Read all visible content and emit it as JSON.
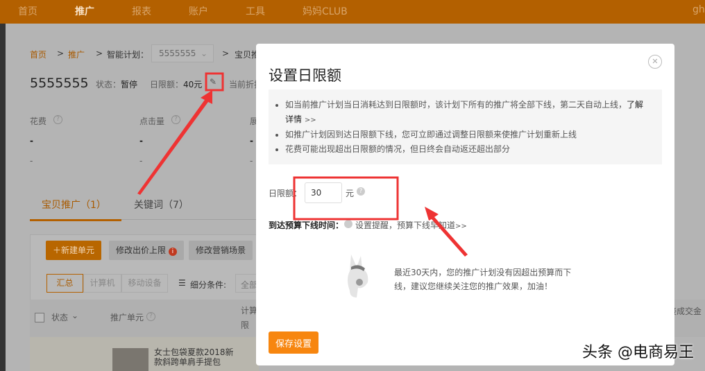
{
  "nav": {
    "items": [
      "首页",
      "推广",
      "报表",
      "账户",
      "工具",
      "妈妈CLUB"
    ],
    "active": 1,
    "user": "ghb"
  },
  "breadcrumb": {
    "home": "首页",
    "promo": "推广",
    "plan_label": "智能计划：",
    "plan_value": "5555555",
    "current": "宝贝推"
  },
  "plan": {
    "name": "5555555",
    "status_label": "状态：",
    "status": "暂停",
    "limit_label": "日限额：",
    "limit": "40元",
    "discount": "当前折扣"
  },
  "metrics": [
    {
      "label": "花费",
      "value": "-",
      "sub": "-"
    },
    {
      "label": "点击量",
      "value": "-",
      "sub": "-"
    },
    {
      "label": "展",
      "value": "-",
      "sub": "-"
    }
  ],
  "tabs": [
    {
      "label": "宝贝推广（1）"
    },
    {
      "label": "关键词（7）"
    }
  ],
  "toolbar": {
    "new_unit": "新建单元",
    "edit_bid": "修改出价上限",
    "edit_scene": "修改营销场景"
  },
  "device_tabs": [
    "汇总",
    "计算机",
    "移动设备"
  ],
  "filter": {
    "label": "细分条件:",
    "value": "全部"
  },
  "table": {
    "headers": [
      "状态",
      "推广单元",
      "计算机",
      "限",
      "接成交金"
    ],
    "row": {
      "title": "女士包袋夏款2018新款斜跨单肩手提包"
    }
  },
  "modal": {
    "title": "设置日限额",
    "tips": [
      "如当前推广计划当日消耗达到日限额时，该计划下所有的推广将全部下线，第二天自动上线，",
      "如推广计划因到达日限额下线，您可立即通过调整日限额来使推广计划重新上线",
      "花费可能出现超出日限额的情况，但日终会自动返还超出部分"
    ],
    "learn_more": "了解详情",
    "more": ">>",
    "limit_label": "日限额：",
    "limit_value": "30",
    "unit": "元",
    "offline_label": "到达预算下线时间：",
    "offline_text": "设置提醒，预算下线早知道",
    "message": "最近30天内，您的推广计划没有因超出预算而下线，建议您继续关注您的推广效果，加油！",
    "save": "保存设置"
  },
  "watermark": "头条 @电商易王",
  "colors": {
    "accent": "#f7860f",
    "nav": "#b36000",
    "annotation": "#ee3333"
  }
}
